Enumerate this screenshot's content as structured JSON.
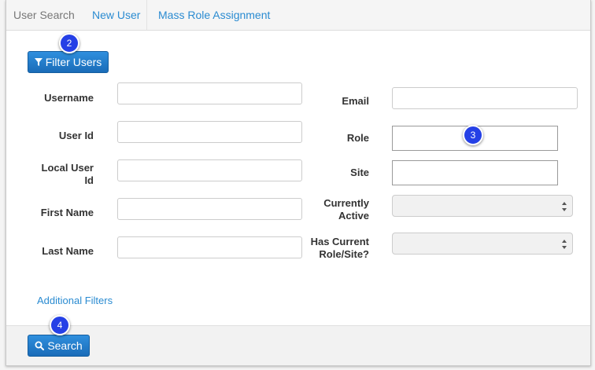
{
  "nav": {
    "tabs": [
      {
        "label": "User Search",
        "active": true
      },
      {
        "label": "New User",
        "active": false
      },
      {
        "label": "Mass Role Assignment",
        "active": false
      }
    ]
  },
  "filter_button": {
    "label": "Filter Users",
    "icon": "filter-icon"
  },
  "form": {
    "left": [
      {
        "label": "Username",
        "value": ""
      },
      {
        "label": "User Id",
        "value": ""
      },
      {
        "label_line1": "Local User",
        "label_line2": "Id",
        "value": ""
      },
      {
        "label": "First Name",
        "value": ""
      },
      {
        "label": "Last Name",
        "value": ""
      }
    ],
    "right": {
      "email": {
        "label": "Email",
        "value": ""
      },
      "role": {
        "label": "Role",
        "value": ""
      },
      "site": {
        "label": "Site",
        "value": ""
      },
      "currently_active": {
        "label_line1": "Currently",
        "label_line2": "Active",
        "value": ""
      },
      "has_current_role_site": {
        "label_line1": "Has Current",
        "label_line2": "Role/Site?",
        "value": ""
      }
    }
  },
  "additional_filters": "Additional Filters",
  "search_button": {
    "label": "Search",
    "icon": "search-icon"
  },
  "callouts": [
    "2",
    "3",
    "4"
  ],
  "colors": {
    "accent": "#1a6cb8",
    "link": "#2a8bd1",
    "badge": "#2540e6"
  }
}
